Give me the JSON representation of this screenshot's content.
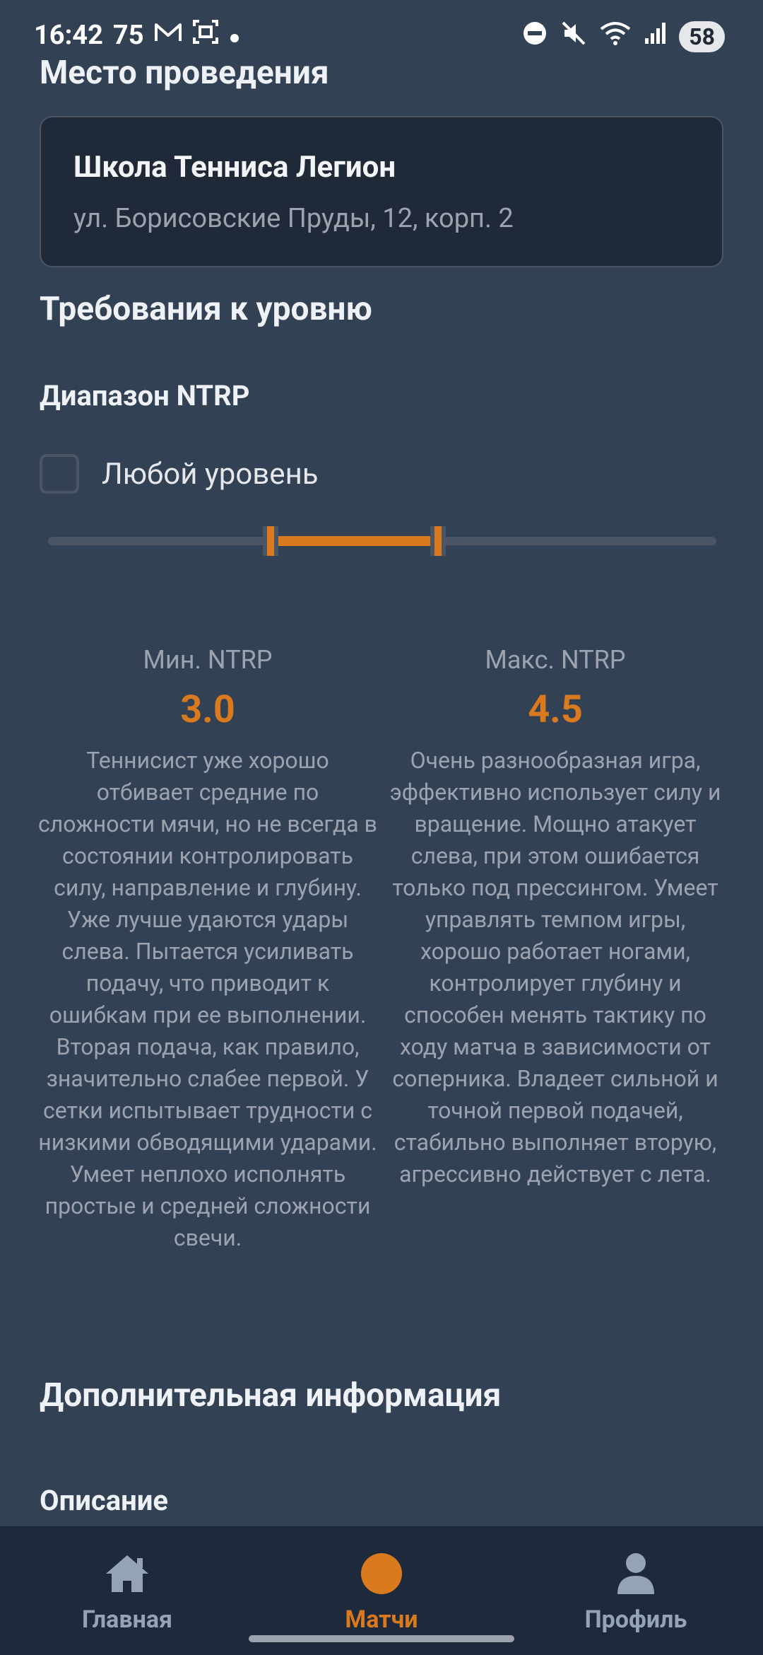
{
  "status_bar": {
    "time": "16:42",
    "notification_count": "75",
    "battery": "58"
  },
  "venue": {
    "section_title": "Место проведения",
    "name": "Школа Тенниса Легион",
    "address": "ул. Борисовские Пруды, 12, корп. 2"
  },
  "level": {
    "section_title": "Требования к уровню",
    "range_title": "Диапазон NTRP",
    "any_level_label": "Любой уровень",
    "any_level_checked": false,
    "slider": {
      "min": 1.0,
      "max": 7.0,
      "low": 3.0,
      "high": 4.5
    },
    "min": {
      "label": "Мин. NTRP",
      "value": "3.0",
      "description": "Теннисист уже хорошо отбивает средние по сложности мячи, но не всегда в состоянии контролировать силу, направление и глубину. Уже лучше удаются удары слева. Пытается усиливать подачу, что приводит к ошибкам при ее выполнении. Вторая подача, как правило, значительно слабее первой. У сетки испытывает трудности с низкими обводящими ударами. Умеет неплохо исполнять простые и средней сложности свечи."
    },
    "max": {
      "label": "Макс. NTRP",
      "value": "4.5",
      "description": "Очень разнообразная игра, эффективно использует силу и вращение. Мощно атакует слева, при этом ошибается только под прессингом. Умеет управлять темпом игры, хорошо работает ногами, контролирует глубину и способен менять тактику по ходу матча в зависимости от соперника. Владеет сильной и точной первой подачей, стабильно выполняет вторую, агрессивно действует с лета."
    }
  },
  "extra": {
    "section_title": "Дополнительная информация",
    "description_title": "Описание"
  },
  "nav": {
    "items": [
      {
        "label": "Главная",
        "icon": "home-icon",
        "active": false
      },
      {
        "label": "Матчи",
        "icon": "tennis-ball-icon",
        "active": true
      },
      {
        "label": "Профиль",
        "icon": "person-icon",
        "active": false
      }
    ]
  },
  "colors": {
    "accent": "#d97a1e",
    "background": "#334155",
    "card": "#1f2937",
    "nav_background": "#1e293b"
  }
}
